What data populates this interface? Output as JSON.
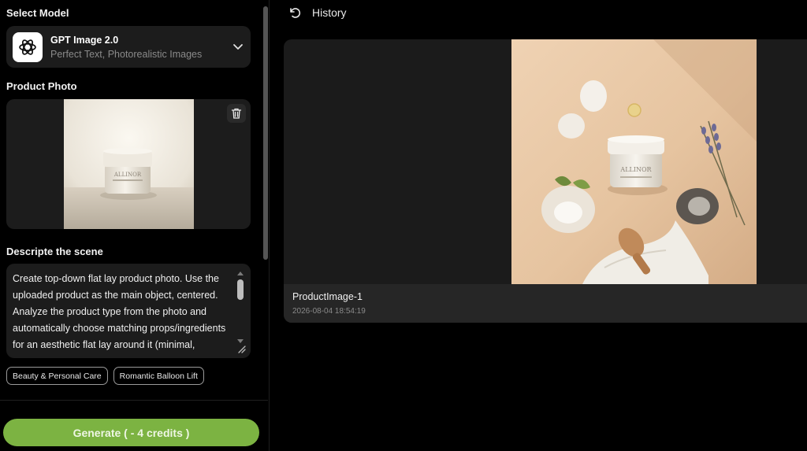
{
  "left": {
    "select_model_label": "Select Model",
    "model": {
      "name": "GPT Image 2.0",
      "description": "Perfect Text, Photorealistic Images",
      "icon": "openai-logo-icon"
    },
    "product_photo_label": "Product Photo",
    "product_photo_brand": "ALLINOR",
    "describe_label": "Descripte the scene",
    "prompt_text": "Create top-down flat lay product photo. Use the\nuploaded product as the main object, centered.\nAnalyze the product type from the photo and\nautomatically choose matching props/ingredients\nfor an aesthetic flat lay around it (minimal,",
    "chips": [
      "Beauty & Personal Care",
      "Romantic Balloon Lift"
    ],
    "generate_label": "Generate ( - 4 credits )"
  },
  "history": {
    "title": "History",
    "items": [
      {
        "name": "ProductImage-1",
        "date": "2026-08-04 18:54:19",
        "brand": "ALLINOR"
      }
    ]
  },
  "colors": {
    "accent_green": "#7cb342",
    "panel_bg": "#1c1c1c",
    "page_bg": "#000000"
  }
}
